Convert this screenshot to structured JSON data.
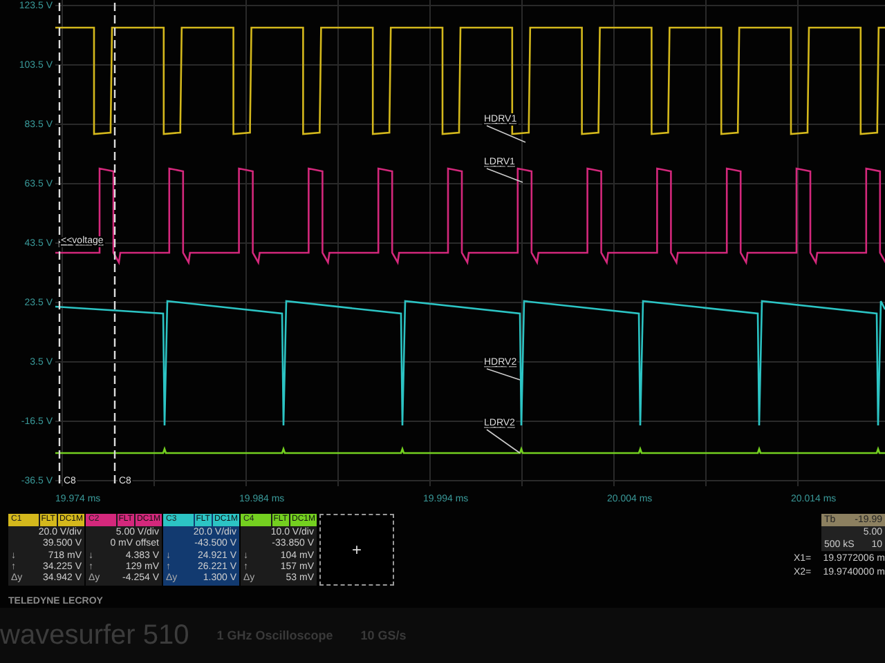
{
  "plot": {
    "y_labels": [
      "123.5 V",
      "103.5 V",
      "83.5 V",
      "63.5 V",
      "43.5 V",
      "23.5 V",
      "3.5 V",
      "-16.5 V",
      "-36.5 V"
    ],
    "trace_labels": [
      "HDRV1",
      "LDRV1",
      "HDRV2",
      "LDRV2"
    ],
    "voltage_tag": "<<voltage",
    "cursor_labels": [
      "C8",
      "C8"
    ]
  },
  "time_labels": [
    "19.974 ms",
    "19.984 ms",
    "19.994 ms",
    "20.004 ms",
    "20.014 ms"
  ],
  "channels": [
    {
      "name": "C1",
      "color": "#d4b81c",
      "selected": false,
      "tags": [
        "FLT",
        "DC1M"
      ],
      "rows": [
        {
          "label": "",
          "value": "20.0 V/div"
        },
        {
          "label": "",
          "value": "39.500 V"
        },
        {
          "label": "↓",
          "value": "718 mV"
        },
        {
          "label": "↑",
          "value": "34.225 V"
        },
        {
          "label": "Δy",
          "value": "34.942 V"
        }
      ]
    },
    {
      "name": "C2",
      "color": "#d4287c",
      "selected": false,
      "tags": [
        "FLT",
        "DC1M"
      ],
      "rows": [
        {
          "label": "",
          "value": "5.00 V/div"
        },
        {
          "label": "",
          "value": "0 mV offset"
        },
        {
          "label": "↓",
          "value": "4.383 V"
        },
        {
          "label": "↑",
          "value": "129 mV"
        },
        {
          "label": "Δy",
          "value": "-4.254 V"
        }
      ]
    },
    {
      "name": "C3",
      "color": "#2cc4c4",
      "selected": true,
      "tags": [
        "FLT",
        "DC1M"
      ],
      "rows": [
        {
          "label": "",
          "value": "20.0 V/div"
        },
        {
          "label": "",
          "value": "-43.500 V"
        },
        {
          "label": "↓",
          "value": "24.921 V"
        },
        {
          "label": "↑",
          "value": "26.221 V"
        },
        {
          "label": "Δy",
          "value": "1.300 V"
        }
      ]
    },
    {
      "name": "C4",
      "color": "#74d020",
      "selected": false,
      "tags": [
        "FLT",
        "DC1M"
      ],
      "rows": [
        {
          "label": "",
          "value": "10.0 V/div"
        },
        {
          "label": "",
          "value": "-33.850 V"
        },
        {
          "label": "↓",
          "value": "104 mV"
        },
        {
          "label": "↑",
          "value": "157 mV"
        },
        {
          "label": "Δy",
          "value": "53 mV"
        }
      ]
    }
  ],
  "add_button": "+",
  "timebase": {
    "label": "Tb",
    "delay": "-19.99",
    "scale": "5.00",
    "samples": "500 kS",
    "rate": "10"
  },
  "cursors": [
    {
      "label": "X1=",
      "value": "19.9772006 m"
    },
    {
      "label": "X2=",
      "value": "19.9740000 m"
    }
  ],
  "brand": "TELEDYNE LECROY",
  "bezel": {
    "model": "wavesurfer 510",
    "description": "1 GHz Oscilloscope",
    "rate": "10 GS/s"
  }
}
